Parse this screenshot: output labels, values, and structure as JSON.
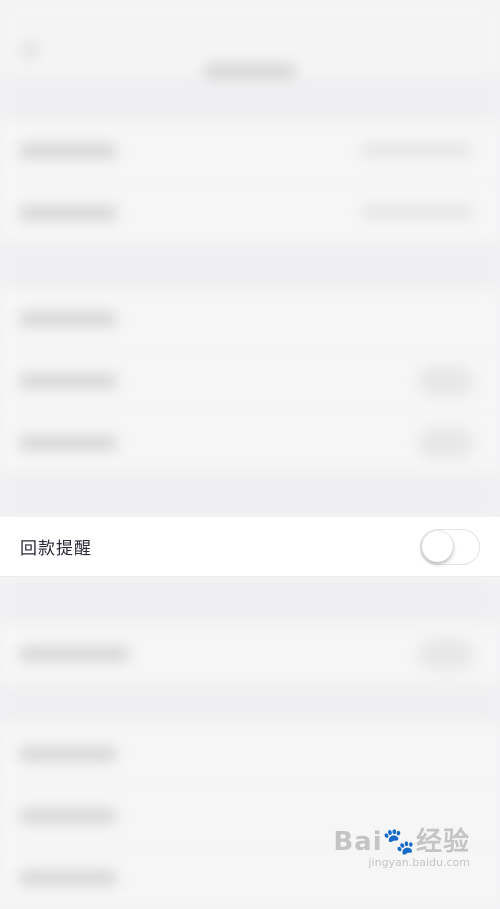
{
  "settings": {
    "repayment_reminder": {
      "label": "回款提醒",
      "enabled": false
    }
  },
  "colors": {
    "background": "#f2f2f4",
    "row_background": "#ffffff",
    "label_text": "#2a2a36",
    "toggle_off_border": "#e3e3e3"
  },
  "watermark": {
    "brand": "Bai",
    "brand_cn": "经验",
    "url": "jingyan.baidu.com"
  }
}
